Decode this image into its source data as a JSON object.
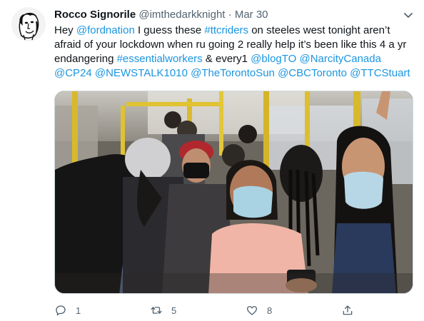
{
  "tweet": {
    "author_name": "Rocco Signorile",
    "handle": "@imthedarkknight",
    "separator": "·",
    "date": "Mar 30",
    "text_segments": [
      {
        "text": "Hey ",
        "link": false
      },
      {
        "text": "@fordnation",
        "link": true
      },
      {
        "text": " I guess these ",
        "link": false
      },
      {
        "text": "#ttcriders",
        "link": true
      },
      {
        "text": " on steeles west tonight aren’t afraid of your lockdown when ru going 2 really help it’s been like this 4 a yr endangering ",
        "link": false
      },
      {
        "text": "#essentialworkers",
        "link": true
      },
      {
        "text": " & every1 ",
        "link": false
      },
      {
        "text": "@blogTO",
        "link": true
      },
      {
        "text": " ",
        "link": false
      },
      {
        "text": "@NarcityCanada",
        "link": true
      },
      {
        "text": " ",
        "link": false
      },
      {
        "text": "@CP24",
        "link": true
      },
      {
        "text": " ",
        "link": false
      },
      {
        "text": "@NEWSTALK1010",
        "link": true
      },
      {
        "text": " ",
        "link": false
      },
      {
        "text": "@TheTorontoSun",
        "link": true
      },
      {
        "text": " ",
        "link": false
      },
      {
        "text": "@CBCToronto",
        "link": true
      },
      {
        "text": " ",
        "link": false
      },
      {
        "text": "@TTCStuart",
        "link": true
      }
    ]
  },
  "actions": {
    "reply_count": "1",
    "retweet_count": "5",
    "like_count": "8",
    "share_count": ""
  },
  "colors": {
    "link": "#1b95e0",
    "muted": "#536471",
    "text": "#0f1419"
  },
  "icons": {
    "reply": "reply-icon",
    "retweet": "retweet-icon",
    "like": "heart-icon",
    "share": "share-icon",
    "more": "chevron-down-icon"
  }
}
